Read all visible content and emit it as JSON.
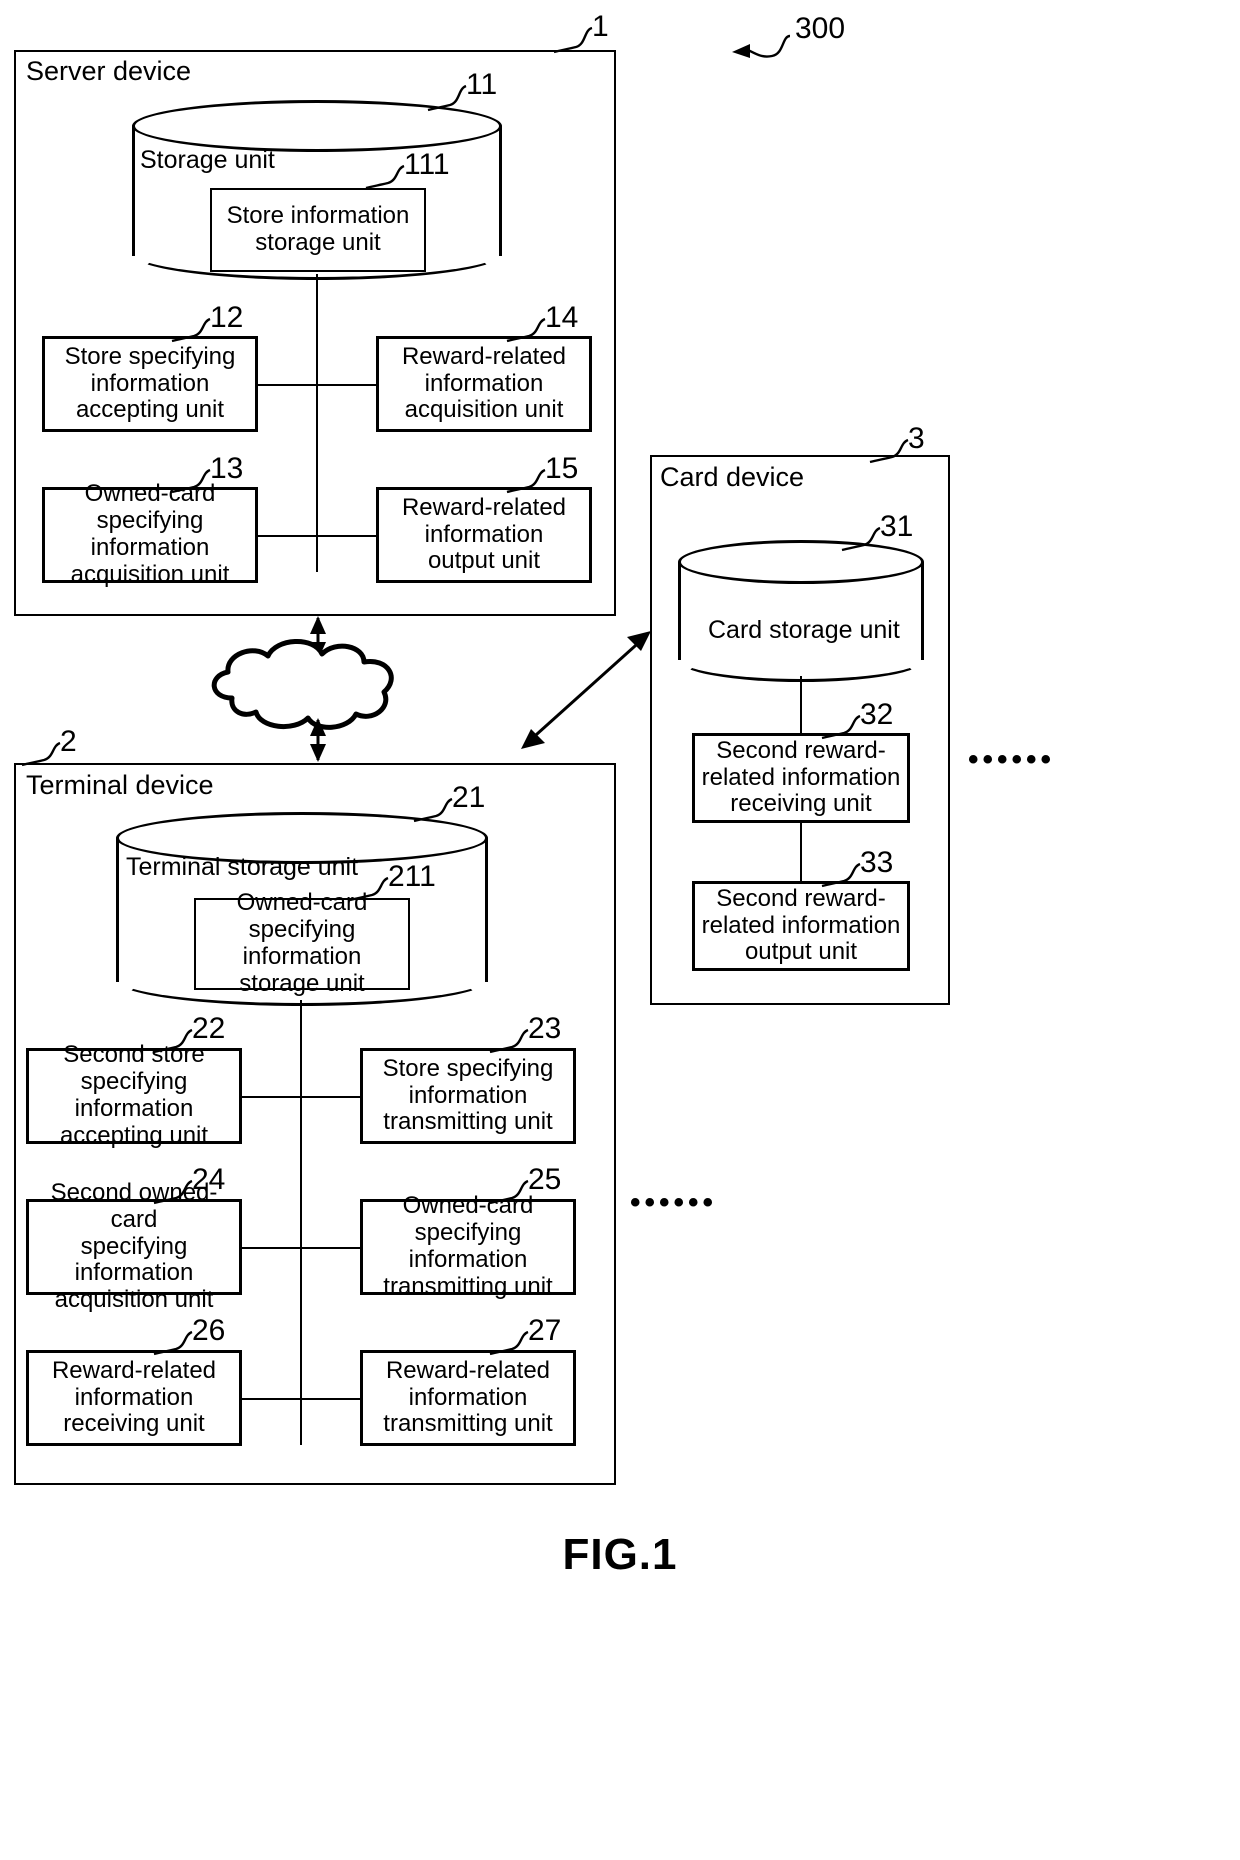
{
  "figure": {
    "caption": "FIG.1",
    "system_ref": "300"
  },
  "server": {
    "title": "Server device",
    "ref": "1",
    "storage": {
      "label": "Storage unit",
      "ref": "11",
      "inner": {
        "label": "Store information\nstorage unit",
        "ref": "111"
      }
    },
    "units": [
      {
        "ref": "12",
        "label": "Store specifying\ninformation\naccepting unit"
      },
      {
        "ref": "14",
        "label": "Reward-related\ninformation\nacquisition unit"
      },
      {
        "ref": "13",
        "label": "Owned-card\nspecifying information\nacquisition unit"
      },
      {
        "ref": "15",
        "label": "Reward-related\ninformation\noutput unit"
      }
    ]
  },
  "card_device": {
    "title": "Card device",
    "ref": "3",
    "storage": {
      "label": "Card storage unit",
      "ref": "31"
    },
    "units": [
      {
        "ref": "32",
        "label": "Second reward-\nrelated information\nreceiving unit"
      },
      {
        "ref": "33",
        "label": "Second reward-\nrelated information\noutput unit"
      }
    ],
    "ellipsis": "••••••"
  },
  "terminal": {
    "title": "Terminal device",
    "ref": "2",
    "storage": {
      "label": "Terminal storage unit",
      "ref": "21",
      "inner": {
        "label": "Owned-card\nspecifying information\nstorage unit",
        "ref": "211"
      }
    },
    "units": [
      {
        "ref": "22",
        "label": "Second store\nspecifying information\naccepting unit"
      },
      {
        "ref": "23",
        "label": "Store specifying\ninformation\ntransmitting unit"
      },
      {
        "ref": "24",
        "label": "Second owned-card\nspecifying information\nacquisition unit"
      },
      {
        "ref": "25",
        "label": "Owned-card\nspecifying information\ntransmitting unit"
      },
      {
        "ref": "26",
        "label": "Reward-related\ninformation\nreceiving unit"
      },
      {
        "ref": "27",
        "label": "Reward-related\ninformation\ntransmitting unit"
      }
    ],
    "ellipsis": "••••••"
  },
  "network": {
    "name": "cloud-network"
  },
  "colors": {
    "ink": "#000000",
    "paper": "#ffffff"
  }
}
